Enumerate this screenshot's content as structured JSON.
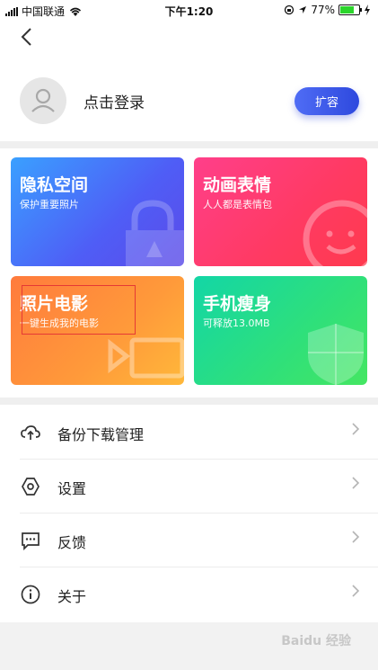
{
  "status_bar": {
    "carrier": "中国联通",
    "time": "下午1:20",
    "battery": "77%",
    "battery_level": 0.77
  },
  "profile": {
    "login_label": "点击登录",
    "expand_label": "扩容"
  },
  "cards": [
    {
      "title": "隐私空间",
      "subtitle": "保护重要照片"
    },
    {
      "title": "动画表情",
      "subtitle": "人人都是表情包"
    },
    {
      "title": "照片电影",
      "subtitle": "一键生成我的电影"
    },
    {
      "title": "手机瘦身",
      "subtitle": "可释放13.0MB"
    }
  ],
  "menu": [
    {
      "label": "备份下载管理",
      "icon": "cloud-upload-icon"
    },
    {
      "label": "设置",
      "icon": "settings-icon"
    },
    {
      "label": "反馈",
      "icon": "feedback-icon"
    },
    {
      "label": "关于",
      "icon": "info-icon"
    }
  ],
  "watermark": "Baidu 经验"
}
